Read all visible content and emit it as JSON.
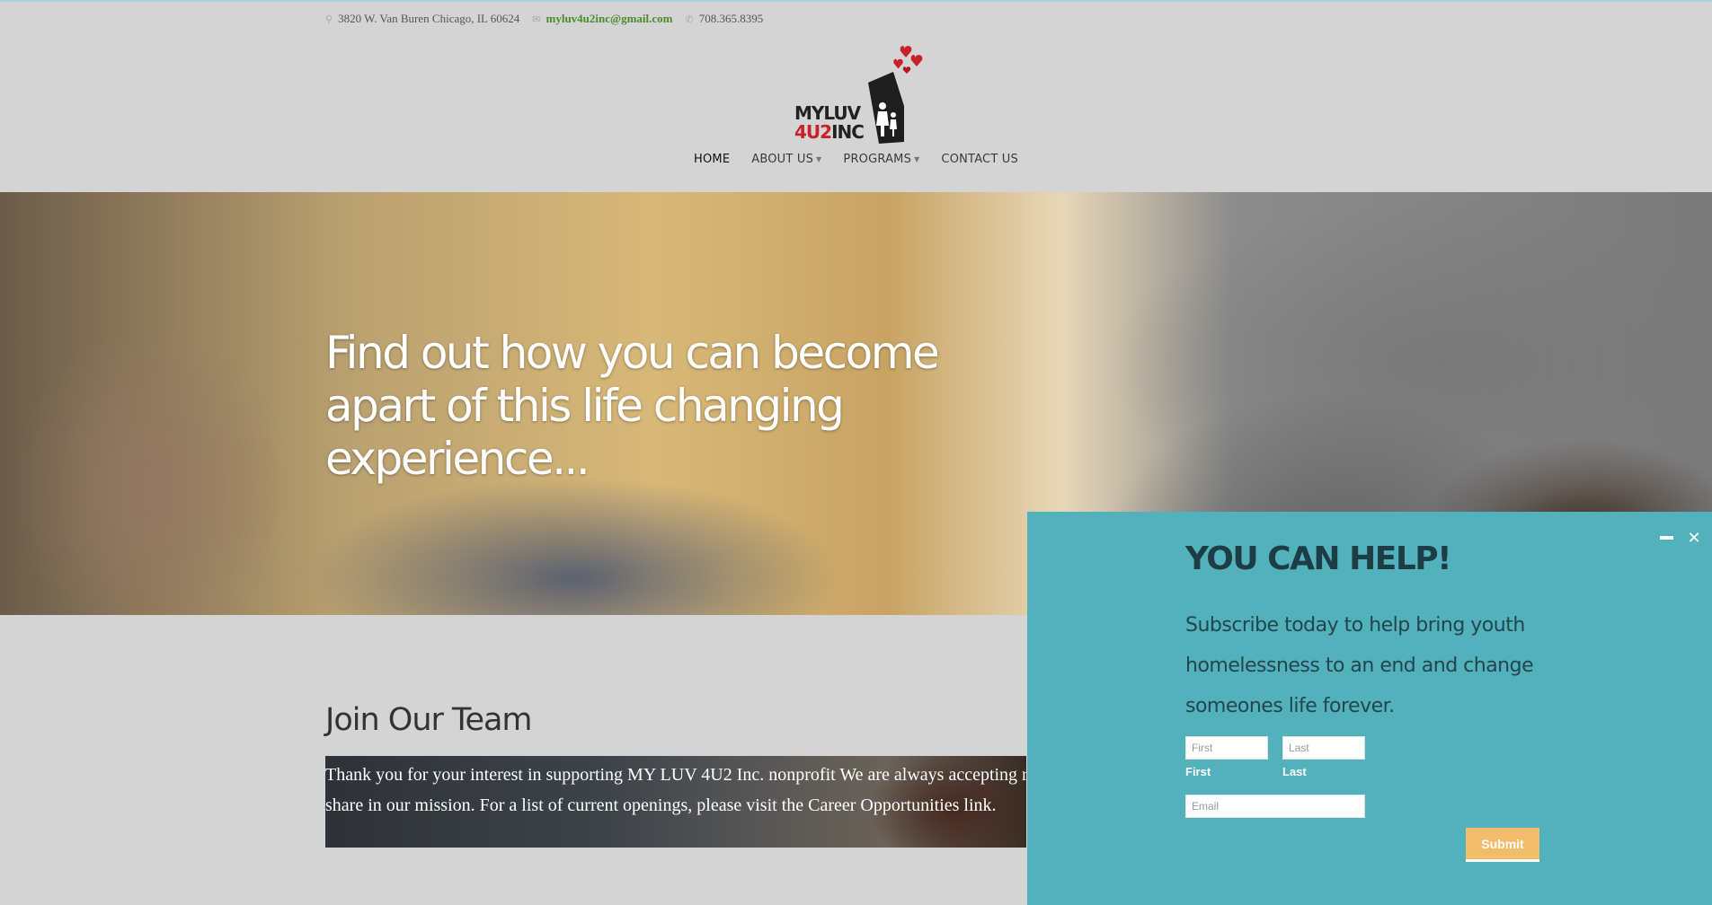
{
  "topbar": {
    "address": "3820 W. Van Buren Chicago, IL 60624",
    "email": "myluv4u2inc@gmail.com",
    "phone": "708.365.8395",
    "address_icon": "map-pin-icon",
    "email_icon": "envelope-icon",
    "phone_icon": "phone-icon"
  },
  "logo": {
    "line1": "MYLUV",
    "line2_red": "4U2",
    "line2_dark": "INC"
  },
  "nav": {
    "home": "HOME",
    "about": "ABOUT US",
    "programs": "PROGRAMS",
    "contact": "CONTACT US"
  },
  "hero": {
    "title": "Find out how you can become apart of this life changing experience..."
  },
  "join": {
    "title": "Join Our Team",
    "text": "Thank you for your interest in supporting MY LUV 4U2 Inc. nonprofit We are always accepting resumes from individuals who want to share in our mission. For a list of current openings, please visit the Career Opportunities link."
  },
  "popup": {
    "heading": "YOU CAN HELP!",
    "description": "Subscribe today to help bring youth homelessness to an end and change someones life forever.",
    "first_placeholder": "First",
    "last_placeholder": "Last",
    "first_label": "First",
    "last_label": "Last",
    "email_placeholder": "Email",
    "submit": "Submit",
    "minimize_icon": "minus-icon",
    "close_icon": "close-icon"
  },
  "colors": {
    "popup_bg": "#53b1bc",
    "submit_bg": "#f2bd6a",
    "email_link": "#4b8d2c",
    "logo_red": "#c9202a"
  }
}
